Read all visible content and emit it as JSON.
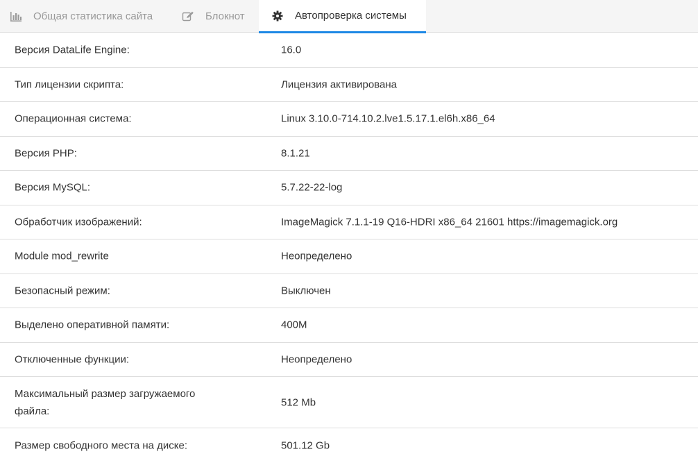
{
  "tabs": [
    {
      "label": "Общая статистика сайта",
      "icon": "bar-chart-icon",
      "active": false
    },
    {
      "label": "Блокнот",
      "icon": "edit-icon",
      "active": false
    },
    {
      "label": "Автопроверка системы",
      "icon": "gear-icon",
      "active": true
    }
  ],
  "rows": [
    {
      "label": "Версия DataLife Engine:",
      "value": "16.0"
    },
    {
      "label": "Тип лицензии скрипта:",
      "value": "Лицензия активирована"
    },
    {
      "label": "Операционная система:",
      "value": "Linux 3.10.0-714.10.2.lve1.5.17.1.el6h.x86_64"
    },
    {
      "label": "Версия PHP:",
      "value": "8.1.21"
    },
    {
      "label": "Версия MySQL:",
      "value": "5.7.22-22-log"
    },
    {
      "label": "Обработчик изображений:",
      "value": "ImageMagick 7.1.1-19 Q16-HDRI x86_64 21601 https://imagemagick.org"
    },
    {
      "label": "Module mod_rewrite",
      "value": "Неопределено"
    },
    {
      "label": "Безопасный режим:",
      "value": "Выключен"
    },
    {
      "label": "Выделено оперативной памяти:",
      "value": "400M"
    },
    {
      "label": "Отключенные функции:",
      "value": "Неопределено"
    },
    {
      "label": "Максимальный размер загружаемого файла:",
      "value": "512 Mb"
    },
    {
      "label": "Размер свободного места на диске:",
      "value": "501.12 Gb"
    }
  ],
  "colors": {
    "accent": "#1e88e5",
    "tab_bg": "#f5f5f5",
    "border": "#dddddd"
  }
}
